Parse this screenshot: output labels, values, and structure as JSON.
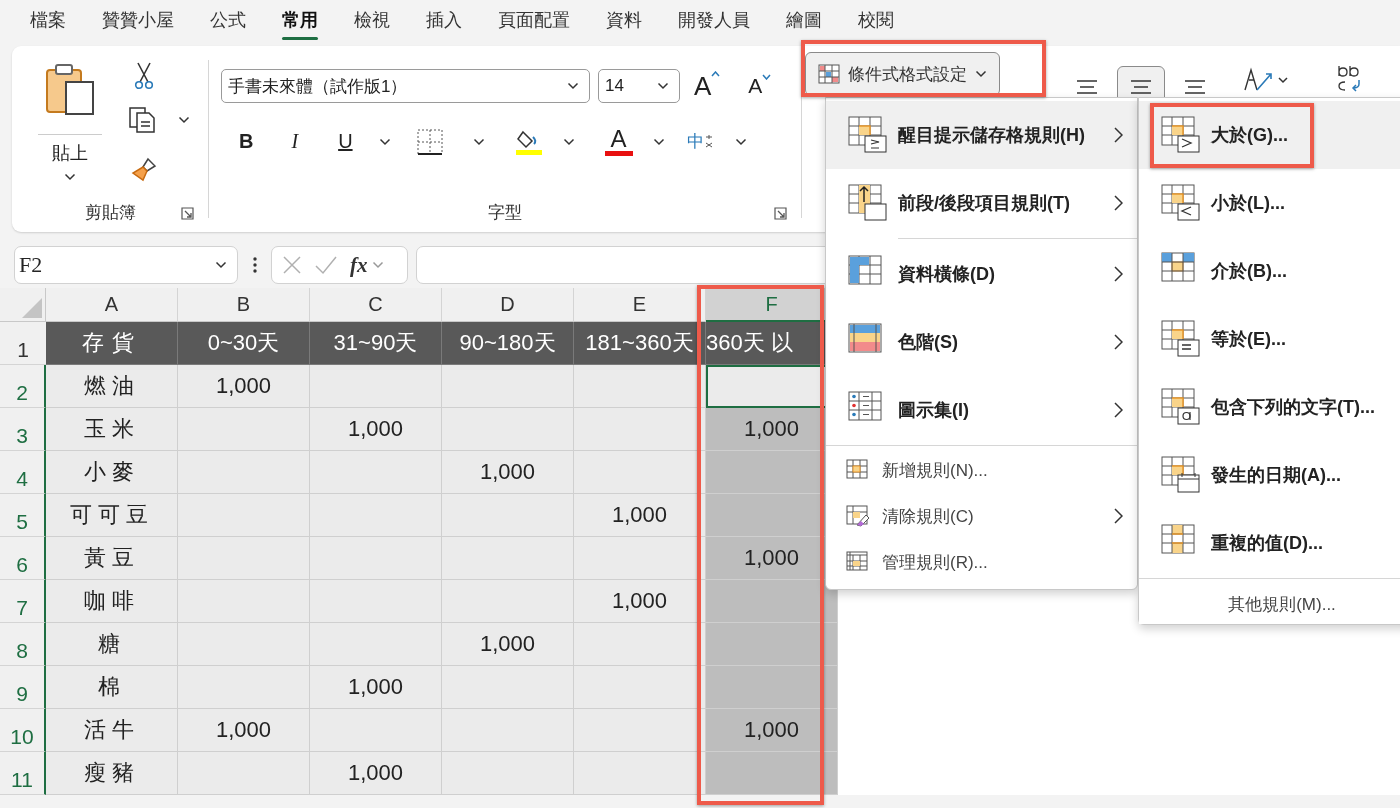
{
  "menu_tabs": [
    {
      "label": "檔案",
      "selected": false
    },
    {
      "label": "贊贊小屋",
      "selected": false
    },
    {
      "label": "公式",
      "selected": false
    },
    {
      "label": "常用",
      "selected": true
    },
    {
      "label": "檢視",
      "selected": false
    },
    {
      "label": "插入",
      "selected": false
    },
    {
      "label": "頁面配置",
      "selected": false
    },
    {
      "label": "資料",
      "selected": false
    },
    {
      "label": "開發人員",
      "selected": false
    },
    {
      "label": "繪圖",
      "selected": false
    },
    {
      "label": "校閱",
      "selected": false
    }
  ],
  "clipboard": {
    "paste_label": "貼上",
    "group_label": "剪貼簿"
  },
  "font": {
    "font_name": "手書未來體（試作版1）",
    "font_size": "14",
    "grow_label": "A",
    "shrink_label": "A",
    "bold_label": "B",
    "italic_label": "I",
    "underline_label": "U",
    "font_color_label": "A",
    "phonetic_label": "中",
    "group_label": "字型"
  },
  "styles": {
    "conditional_formatting_label": "條件式格式設定"
  },
  "alignment": [
    {
      "selected": false
    },
    {
      "selected": true
    },
    {
      "selected": false
    }
  ],
  "formula_bar": {
    "name_box": "F2",
    "function_label": "fx"
  },
  "sheet": {
    "columns": [
      {
        "label": "A",
        "selected": false
      },
      {
        "label": "B",
        "selected": false
      },
      {
        "label": "C",
        "selected": false
      },
      {
        "label": "D",
        "selected": false
      },
      {
        "label": "E",
        "selected": false
      },
      {
        "label": "F",
        "selected": true
      }
    ],
    "rows": [
      {
        "number": "1",
        "selected": false,
        "kind": "header",
        "cells": [
          "存貨",
          "0~30天",
          "31~90天",
          "90~180天",
          "181~360天",
          "360天 以"
        ]
      },
      {
        "number": "2",
        "selected": true,
        "kind": "data",
        "cells": [
          "燃油",
          "1,000",
          "",
          "",
          "",
          ""
        ]
      },
      {
        "number": "3",
        "selected": true,
        "kind": "data",
        "cells": [
          "玉米",
          "",
          "1,000",
          "",
          "",
          "1,000"
        ]
      },
      {
        "number": "4",
        "selected": true,
        "kind": "data",
        "cells": [
          "小麥",
          "",
          "",
          "1,000",
          "",
          ""
        ]
      },
      {
        "number": "5",
        "selected": true,
        "kind": "data",
        "cells": [
          "可可豆",
          "",
          "",
          "",
          "1,000",
          ""
        ]
      },
      {
        "number": "6",
        "selected": true,
        "kind": "data",
        "cells": [
          "黃豆",
          "",
          "",
          "",
          "",
          "1,000"
        ]
      },
      {
        "number": "7",
        "selected": true,
        "kind": "data",
        "cells": [
          "咖啡",
          "",
          "",
          "",
          "1,000",
          ""
        ]
      },
      {
        "number": "8",
        "selected": true,
        "kind": "data",
        "cells": [
          "糖",
          "",
          "",
          "1,000",
          "",
          ""
        ]
      },
      {
        "number": "9",
        "selected": true,
        "kind": "data",
        "cells": [
          "棉",
          "",
          "1,000",
          "",
          "",
          ""
        ]
      },
      {
        "number": "10",
        "selected": true,
        "kind": "data",
        "cells": [
          "活牛",
          "1,000",
          "",
          "",
          "",
          "1,000"
        ]
      },
      {
        "number": "11",
        "selected": true,
        "kind": "data",
        "cells": [
          "瘦豬",
          "",
          "1,000",
          "",
          "",
          ""
        ]
      }
    ]
  },
  "conditional_menu": {
    "items": [
      {
        "kind": "large",
        "label": "醒目提示儲存格規則(H)",
        "submenu": true,
        "selected": true
      },
      {
        "kind": "large",
        "label": "前段/後段項目規則(T)",
        "submenu": true,
        "selected": false
      },
      {
        "kind": "large",
        "label": "資料橫條(D)",
        "submenu": true,
        "selected": false
      },
      {
        "kind": "large",
        "label": "色階(S)",
        "submenu": true,
        "selected": false
      },
      {
        "kind": "large",
        "label": "圖示集(I)",
        "submenu": true,
        "selected": false
      },
      {
        "kind": "small",
        "label": "新增規則(N)...",
        "submenu": false,
        "selected": false
      },
      {
        "kind": "small",
        "label": "清除規則(C)",
        "submenu": true,
        "selected": false
      },
      {
        "kind": "small",
        "label": "管理規則(R)...",
        "submenu": false,
        "selected": false
      }
    ]
  },
  "submenu": {
    "items": [
      {
        "label": "大於(G)...",
        "selected": true
      },
      {
        "label": "小於(L)...",
        "selected": false
      },
      {
        "label": "介於(B)...",
        "selected": false
      },
      {
        "label": "等於(E)...",
        "selected": false
      },
      {
        "label": "包含下列的文字(T)...",
        "selected": false
      },
      {
        "label": "發生的日期(A)...",
        "selected": false
      },
      {
        "label": "重複的值(D)...",
        "selected": false
      }
    ],
    "more_label": "其他規則(M)..."
  }
}
